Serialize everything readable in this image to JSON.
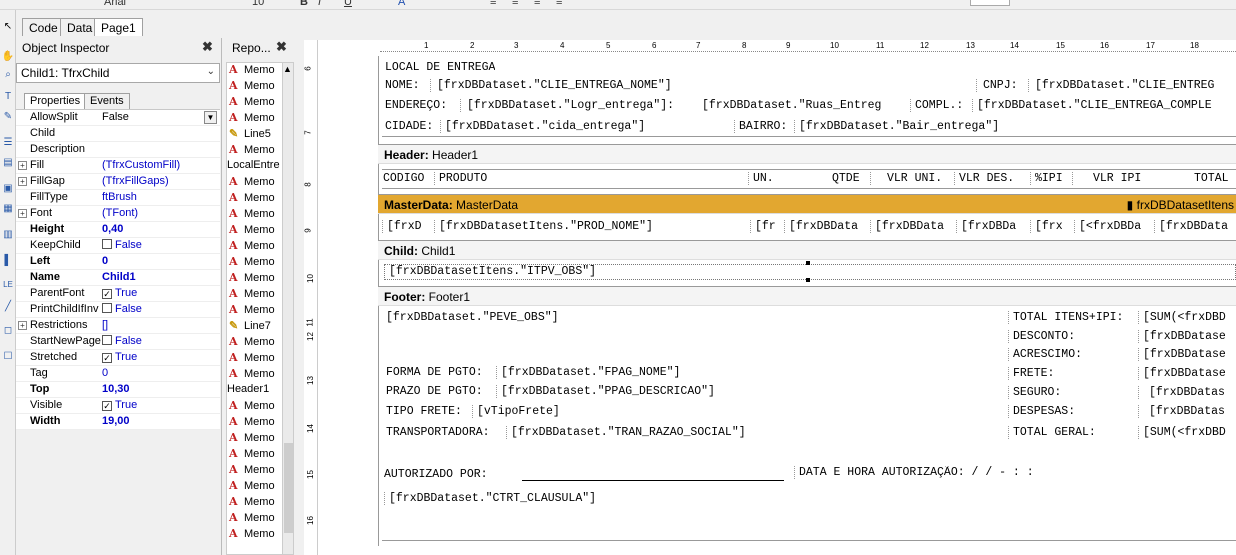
{
  "toolbar": {
    "font_name": "Arial",
    "font_size": "10"
  },
  "tabs": {
    "code": "Code",
    "data": "Data",
    "page1": "Page1"
  },
  "object_inspector": {
    "title": "Object Inspector",
    "selected": "Child1: TfrxChild",
    "tab_properties": "Properties",
    "tab_events": "Events",
    "props": [
      {
        "k": "AllowSplit",
        "v": "False"
      },
      {
        "k": "Child",
        "v": ""
      },
      {
        "k": "Description",
        "v": ""
      },
      {
        "k": "Fill",
        "v": "(TfrxCustomFill)"
      },
      {
        "k": "FillGap",
        "v": "(TfrxFillGaps)"
      },
      {
        "k": "FillType",
        "v": "ftBrush"
      },
      {
        "k": "Font",
        "v": "(TFont)"
      },
      {
        "k": "Height",
        "v": "0,40"
      },
      {
        "k": "KeepChild",
        "v": "False"
      },
      {
        "k": "Left",
        "v": "0"
      },
      {
        "k": "Name",
        "v": "Child1"
      },
      {
        "k": "ParentFont",
        "v": "True"
      },
      {
        "k": "PrintChildIfInv",
        "v": "False"
      },
      {
        "k": "Restrictions",
        "v": "[]"
      },
      {
        "k": "StartNewPage",
        "v": "False"
      },
      {
        "k": "Stretched",
        "v": "True"
      },
      {
        "k": "Tag",
        "v": "0"
      },
      {
        "k": "Top",
        "v": "10,30"
      },
      {
        "k": "Visible",
        "v": "True"
      },
      {
        "k": "Width",
        "v": "19,00"
      }
    ]
  },
  "report_tree": {
    "title": "Repo...",
    "items": [
      "Memo",
      "Memo",
      "Memo",
      "Memo",
      "Line5",
      "Memo",
      "LocalEntre",
      "Memo",
      "Memo",
      "Memo",
      "Memo",
      "Memo",
      "Memo",
      "Memo",
      "Memo",
      "Memo",
      "Line7",
      "Memo",
      "Memo",
      "Memo",
      "Header1",
      "Memo",
      "Memo",
      "Memo",
      "Memo",
      "Memo",
      "Memo",
      "Memo",
      "Memo",
      "Memo"
    ]
  },
  "ruler": {
    "h": [
      "1",
      "2",
      "3",
      "4",
      "5",
      "6",
      "7",
      "8",
      "9",
      "10",
      "11",
      "12",
      "13",
      "14",
      "15",
      "16",
      "17",
      "18"
    ],
    "v": [
      "6",
      "7",
      "8",
      "9",
      "10",
      "11",
      "12",
      "13",
      "14",
      "15",
      "16"
    ]
  },
  "local": {
    "title": "LOCAL DE ENTREGA",
    "nome_label": "NOME:",
    "nome_val": "[frxDBDataset.\"CLIE_ENTREGA_NOME\"]",
    "cnpj_label": "CNPJ:",
    "cnpj_val": "[frxDBDataset.\"CLIE_ENTREG",
    "end_label": "ENDEREÇO:",
    "end_val": "[frxDBDataset.\"Logr_entrega\"]:",
    "ruas_val": "[frxDBDataset.\"Ruas_Entreg",
    "compl_label": "COMPL.:",
    "compl_val": "[frxDBDataset.\"CLIE_ENTREGA_COMPLE",
    "cidade_label": "CIDADE:",
    "cidade_val": "[frxDBDataset.\"cida_entrega\"]",
    "bairro_label": "BAIRRO:",
    "bairro_val": "[frxDBDataset.\"Bair_entrega\"]"
  },
  "header": {
    "band": "Header:",
    "name": "Header1",
    "cols": [
      "CÓDIGO",
      "PRODUTO",
      "UN.",
      "QTDE",
      "VLR UNI.",
      "VLR DES.",
      "%IPI",
      "VLR IPI",
      "TOTAL"
    ]
  },
  "master": {
    "band": "MasterData:",
    "name": "MasterData",
    "dataset": "frxDBDatasetItens",
    "cells": [
      "[frxD",
      "[frxDBDatasetItens.\"PROD_NOME\"]",
      "[fr",
      "[frxDBData",
      "[frxDBData",
      "[frxDBDa",
      "[frx",
      "[<frxDBDa",
      "[frxDBData"
    ]
  },
  "child": {
    "band": "Child:",
    "name": "Child1",
    "memo": "[frxDBDatasetItens.\"ITPV_OBS\"]"
  },
  "footer": {
    "band": "Footer:",
    "name": "Footer1",
    "obs": "[frxDBDataset.\"PEVE_OBS\"]",
    "forma_label": "FORMA DE PGTO:",
    "forma_val": "[frxDBDataset.\"FPAG_NOME\"]",
    "prazo_label": "PRAZO DE PGTO:",
    "prazo_val": "[frxDBDataset.\"PPAG_DESCRICAO\"]",
    "tipo_label": "TIPO FRETE:",
    "tipo_val": "[vTipoFrete]",
    "transp_label": "TRANSPORTADORA:",
    "transp_val": "[frxDBDataset.\"TRAN_RAZAO_SOCIAL\"]",
    "autor_label": "AUTORIZADO POR:",
    "data_label": "DATA E HORA AUTORIZAÇÃO:   /   /      -     :     :",
    "clausula": "[frxDBDataset.\"CTRT_CLAUSULA\"]",
    "totals": [
      {
        "k": "TOTAL ITENS+IPI:",
        "v": "[SUM(<frxDBD"
      },
      {
        "k": "DESCONTO:",
        "v": "[frxDBDatase"
      },
      {
        "k": "ACRESCIMO:",
        "v": "[frxDBDatase"
      },
      {
        "k": "FRETE:",
        "v": "[frxDBDatase"
      },
      {
        "k": "SEGURO:",
        "v": "[frxDBDatas"
      },
      {
        "k": "DESPESAS:",
        "v": "[frxDBDatas"
      },
      {
        "k": "TOTAL GERAL:",
        "v": "[SUM(<frxDBD"
      }
    ]
  }
}
